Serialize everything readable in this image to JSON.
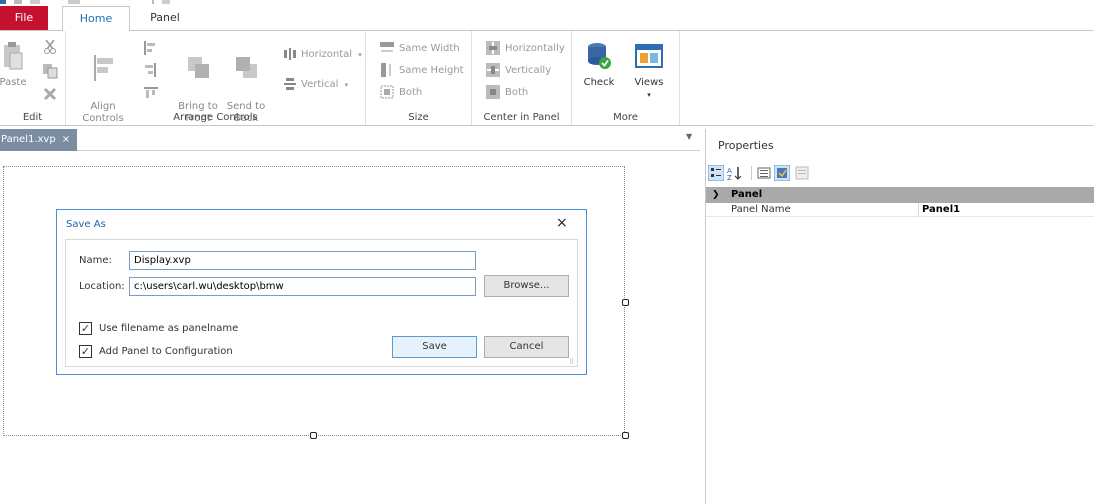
{
  "ribbon": {
    "tabs": [
      {
        "label": "File"
      },
      {
        "label": "Home"
      },
      {
        "label": "Panel"
      }
    ],
    "groups": {
      "edit": {
        "label": "Edit",
        "paste": "Paste"
      },
      "arrange": {
        "label": "Arrange Controls",
        "align_controls": "Align\nControls",
        "bring_to_front": "Bring to\nFront",
        "send_to_back": "Send to\nBack",
        "horizontal": "Horizontal",
        "vertical": "Vertical"
      },
      "size": {
        "label": "Size",
        "same_width": "Same Width",
        "same_height": "Same Height",
        "both": "Both"
      },
      "center": {
        "label": "Center in Panel",
        "horizontally": "Horizontally",
        "vertically": "Vertically",
        "both": "Both"
      },
      "more": {
        "label": "More",
        "check": "Check",
        "views": "Views"
      }
    }
  },
  "document_tab": {
    "label": "Panel1.xvp",
    "close": "×"
  },
  "dialog": {
    "title": "Save As",
    "close": "×",
    "name_label": "Name:",
    "name_value": "Display.xvp",
    "location_label": "Location:",
    "location_value": "c:\\users\\carl.wu\\desktop\\bmw",
    "browse": "Browse...",
    "use_filename_label": "Use filename as panelname",
    "use_filename_checked": true,
    "add_panel_label": "Add Panel to Configuration",
    "add_panel_checked": true,
    "save": "Save",
    "cancel": "Cancel"
  },
  "properties": {
    "title": "Properties",
    "category": "Panel",
    "rows": [
      {
        "name": "Panel Name",
        "value": "Panel1"
      }
    ]
  },
  "colors": {
    "file_tab": "#c5112f",
    "accent_blue": "#1e63b0",
    "doc_tab": "#7a8da3"
  }
}
